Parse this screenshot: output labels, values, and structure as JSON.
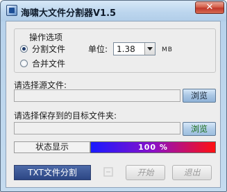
{
  "window": {
    "title": "海啸大文件分割器V1.5",
    "close_glyph": "✕"
  },
  "options": {
    "group_title": "操作选项",
    "split_label": "分割文件",
    "merge_label": "合并文件",
    "selected_mode": "split",
    "unit_label": "单位:",
    "size_value": "1.38",
    "size_unit": "MB"
  },
  "source": {
    "label": "请选择源文件:",
    "value": "",
    "browse_label": "浏览"
  },
  "target": {
    "label": "请选择保存到的目标文件夹:",
    "value": "",
    "browse_label": "浏览"
  },
  "status": {
    "label": "状态显示",
    "progress_percent": 100,
    "progress_text": "100 %"
  },
  "actions": {
    "txt_split_label": "TXT文件分割",
    "start_label": "开始",
    "exit_label": "退出"
  },
  "colors": {
    "title_bar": "#bcd6ee",
    "close_button": "#c0392b",
    "txt_button": "#2c4684",
    "progress_start": "#1a1aff",
    "progress_end": "#ff1010"
  }
}
